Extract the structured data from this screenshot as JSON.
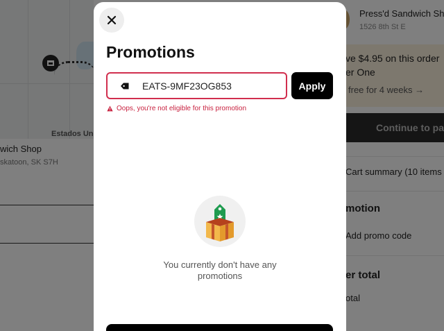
{
  "background": {
    "map": {
      "country_label": "Estados Un"
    },
    "store_left": {
      "name": "wich Shop",
      "address": "skatoon, SK S7H"
    },
    "store_right": {
      "name": "Press'd Sandwich Sh",
      "address": "1526 8th St E"
    },
    "promo_banner": {
      "line1": "ve $4.95 on this order",
      "line2": "er One",
      "line3": "free for 4 weeks →"
    },
    "continue_label": "Continue to pa",
    "cart_summary": "Cart summary (10 items",
    "promotion_heading": "motion",
    "add_promo": "Add promo code",
    "order_total_heading": "er total",
    "total_label": "otal"
  },
  "modal": {
    "title": "Promotions",
    "promo_code_value": "EATS-9MF23OG853",
    "apply_label": "Apply",
    "error_message": "Oops, you're not eligible for this promotion",
    "empty_text": "You currently don't have any promotions"
  },
  "colors": {
    "error": "#c8213f",
    "input_border_error": "#d12e4e",
    "banner_bg": "#fbf1dd",
    "tag_green": "#1e9b4f"
  },
  "icons": {
    "close": "close-icon",
    "tag": "tag-icon",
    "warning": "warning-icon",
    "empty": "gift-box-icon"
  }
}
